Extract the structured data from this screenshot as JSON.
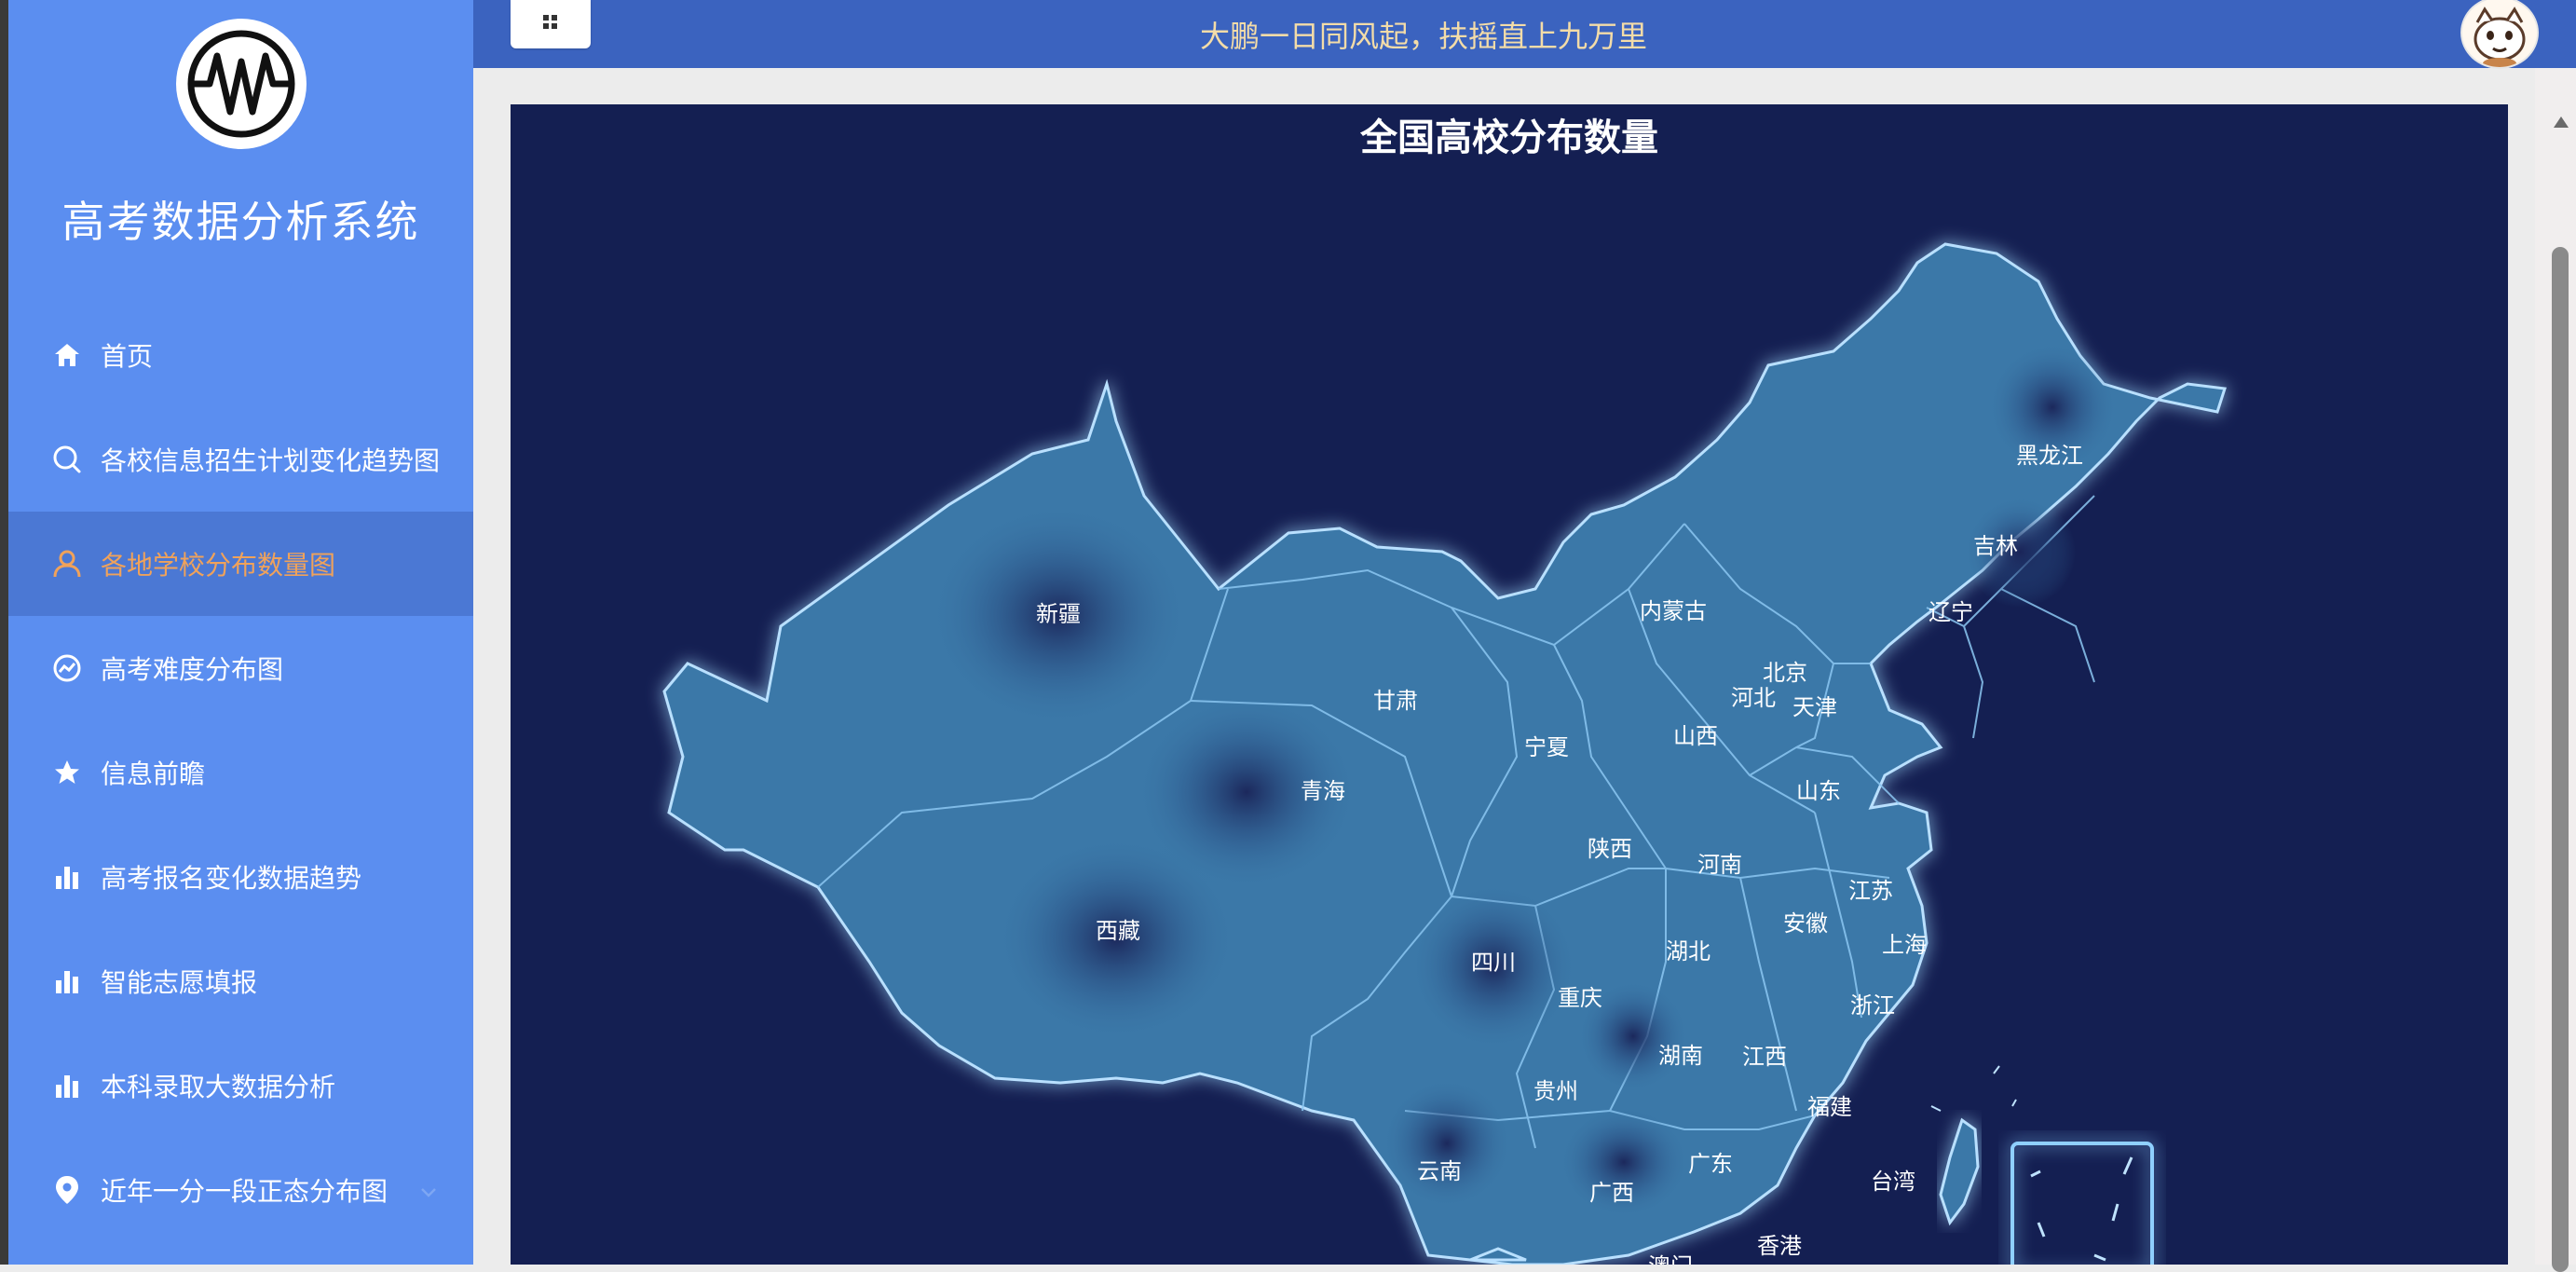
{
  "sidebar": {
    "app_title": "高考数据分析系统",
    "items": [
      {
        "label": "首页",
        "icon": "home-icon"
      },
      {
        "label": "各校信息招生计划变化趋势图",
        "icon": "search-icon"
      },
      {
        "label": "各地学校分布数量图",
        "icon": "user-icon",
        "active": true
      },
      {
        "label": "高考难度分布图",
        "icon": "gauge-icon"
      },
      {
        "label": "信息前瞻",
        "icon": "star-icon"
      },
      {
        "label": "高考报名变化数据趋势",
        "icon": "bar-chart-icon"
      },
      {
        "label": "智能志愿填报",
        "icon": "bar-chart-icon"
      },
      {
        "label": "本科录取大数据分析",
        "icon": "bar-chart-icon"
      },
      {
        "label": "近年一分一段正态分布图",
        "icon": "location-pin-icon"
      }
    ]
  },
  "header": {
    "slogan": "大鹏一日同风起，扶摇直上九万里"
  },
  "colors": {
    "sidebar_bg": "#5b8ef0",
    "sidebar_active_bg": "#4b78d4",
    "active_text": "#f0a25a",
    "topbar_bg": "#3b63bf",
    "slogan_text": "#f3dca8",
    "map_bg": "#141f52",
    "province_fill": "#3a78a8",
    "province_border": "#a9d4ff"
  },
  "map": {
    "title": "全国高校分布数量",
    "provinces": [
      "新疆",
      "西藏",
      "青海",
      "甘肃",
      "内蒙古",
      "黑龙江",
      "吉林",
      "辽宁",
      "北京",
      "天津",
      "河北",
      "山西",
      "宁夏",
      "陕西",
      "山东",
      "河南",
      "江苏",
      "安徽",
      "上海",
      "浙江",
      "湖北",
      "四川",
      "重庆",
      "湖南",
      "江西",
      "福建",
      "贵州",
      "云南",
      "广西",
      "广东",
      "台湾",
      "香港",
      "澳门"
    ]
  }
}
